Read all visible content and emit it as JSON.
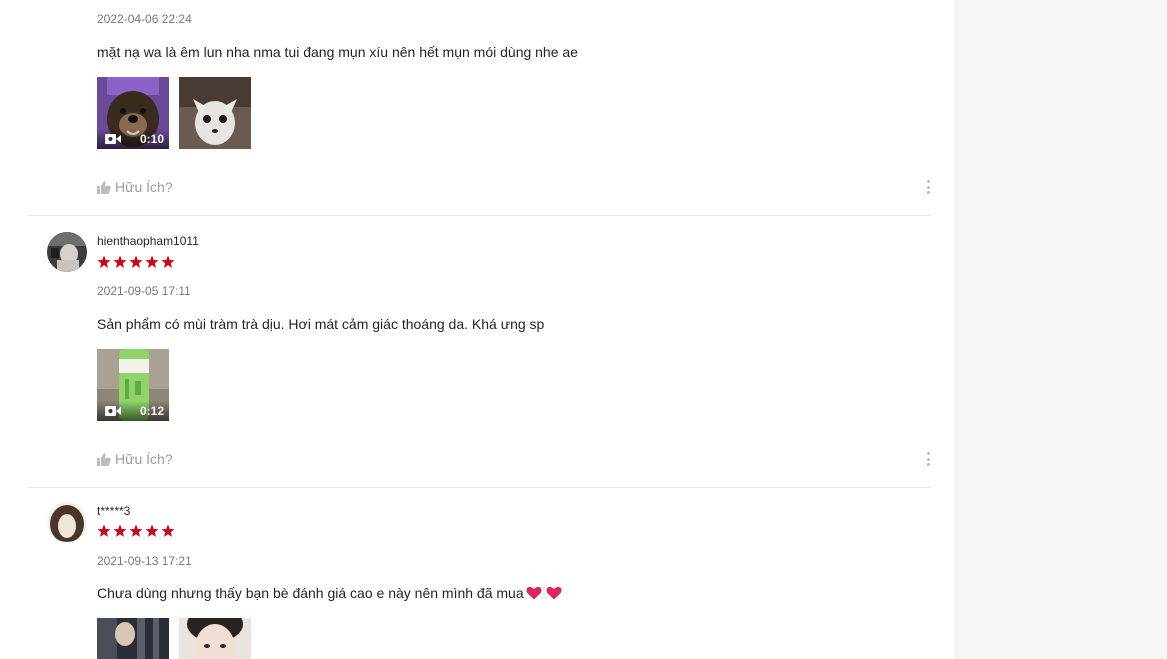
{
  "colors": {
    "star": "#d0011b",
    "heart": "#e0245e"
  },
  "reviews": [
    {
      "date": "2022-04-06 22:24",
      "comment": "mặt nạ wa là êm lun nha nma tui đang mụn xíu nên hết mụn mói dùng nhe ae",
      "media": [
        {
          "type": "video",
          "duration": "0:10",
          "icon": "video-camera-icon"
        },
        {
          "type": "image"
        }
      ],
      "helpful_label": "Hữu Ích?"
    },
    {
      "username": "hienthaopham1011",
      "rating": 5,
      "date": "2021-09-05 17:11",
      "comment": "Sản phẩm có mùi tràm trà dịu. Hơi mát cảm giác thoáng da. Khá ưng sp",
      "media": [
        {
          "type": "video",
          "duration": "0:12",
          "icon": "video-camera-icon"
        }
      ],
      "helpful_label": "Hữu Ích?"
    },
    {
      "username": "t*****3",
      "rating": 5,
      "date": "2021-09-13 17:21",
      "comment": "Chưa dùng nhưng thấy bạn bè đánh giá cao e này nên mình đã mua",
      "media": [
        {
          "type": "image"
        },
        {
          "type": "image"
        }
      ]
    }
  ]
}
